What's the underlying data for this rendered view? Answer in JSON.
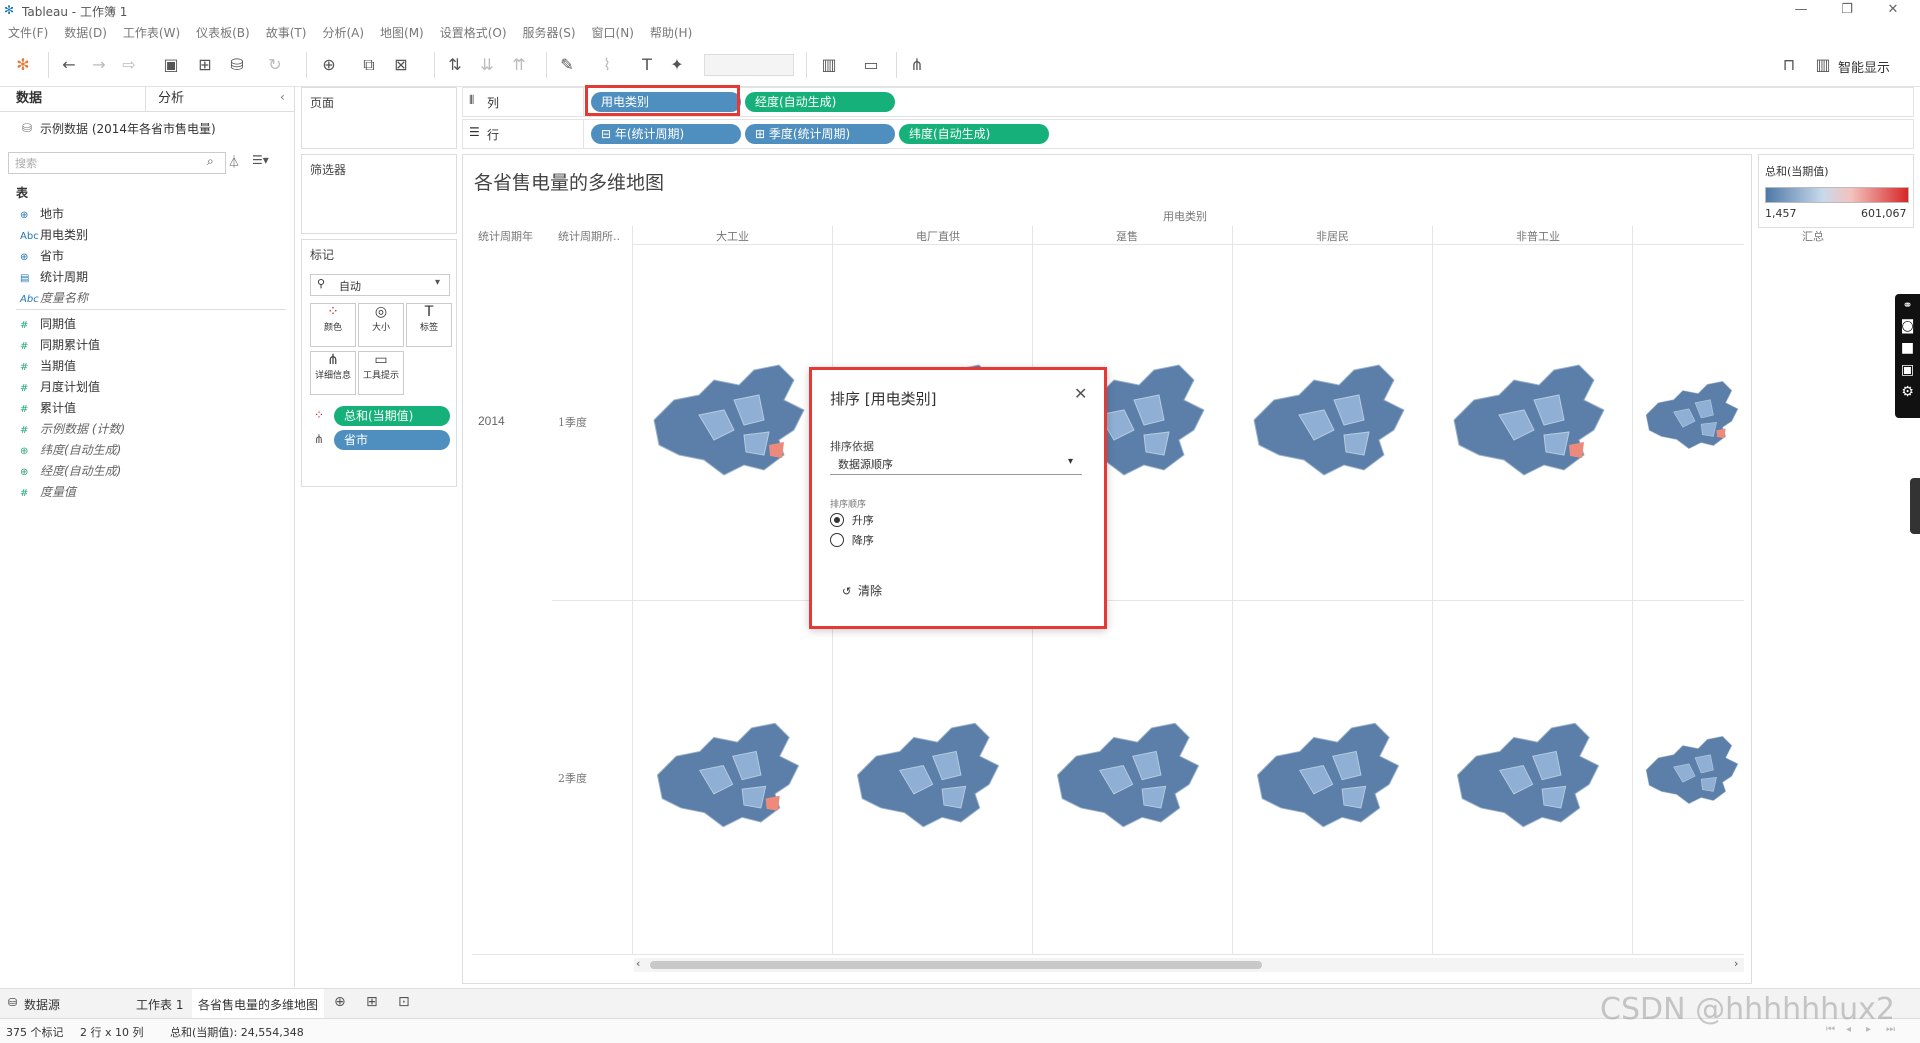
{
  "window": {
    "title": "Tableau - 工作簿 1"
  },
  "menu": [
    "文件(F)",
    "数据(D)",
    "工作表(W)",
    "仪表板(B)",
    "故事(T)",
    "分析(A)",
    "地图(M)",
    "设置格式(O)",
    "服务器(S)",
    "窗口(N)",
    "帮助(H)"
  ],
  "toolbar": {
    "show_me": "智能显示"
  },
  "left": {
    "tabs": [
      "数据",
      "分析"
    ],
    "datasource": "示例数据 (2014年各省市售电量)",
    "search_placeholder": "搜索",
    "section": "表",
    "dimensions": [
      {
        "icon": "globe-icon",
        "glyph": "⊕",
        "label": "地市",
        "italic": false
      },
      {
        "icon": "abc-icon",
        "glyph": "Abc",
        "label": "用电类别",
        "italic": false
      },
      {
        "icon": "globe-icon",
        "glyph": "⊕",
        "label": "省市",
        "italic": false
      },
      {
        "icon": "calendar-icon",
        "glyph": "▤",
        "label": "统计周期",
        "italic": false
      },
      {
        "icon": "abc-icon",
        "glyph": "Abc",
        "label": "度量名称",
        "italic": true
      }
    ],
    "measures": [
      {
        "icon": "hash-icon",
        "glyph": "#",
        "label": "同期值",
        "italic": false
      },
      {
        "icon": "hash-icon",
        "glyph": "#",
        "label": "同期累计值",
        "italic": false
      },
      {
        "icon": "hash-icon",
        "glyph": "#",
        "label": "当期值",
        "italic": false
      },
      {
        "icon": "hash-icon",
        "glyph": "#",
        "label": "月度计划值",
        "italic": false
      },
      {
        "icon": "hash-icon",
        "glyph": "#",
        "label": "累计值",
        "italic": false
      },
      {
        "icon": "hash-icon",
        "glyph": "#",
        "label": "示例数据 (计数)",
        "italic": true
      },
      {
        "icon": "globe-icon",
        "glyph": "⊕",
        "label": "纬度(自动生成)",
        "italic": true
      },
      {
        "icon": "globe-icon",
        "glyph": "⊕",
        "label": "经度(自动生成)",
        "italic": true
      },
      {
        "icon": "hash-icon",
        "glyph": "#",
        "label": "度量值",
        "italic": true
      }
    ]
  },
  "panels": {
    "pages": "页面",
    "filters": "筛选器",
    "marks": "标记"
  },
  "marks": {
    "type": "自动",
    "buttons": [
      "颜色",
      "大小",
      "标签",
      "详细信息",
      "工具提示"
    ],
    "pills": [
      {
        "label": "总和(当期值)",
        "color": "#16b07a"
      },
      {
        "label": "省市",
        "color": "#4f8fbf"
      }
    ]
  },
  "shelves": {
    "columns_label": "列",
    "rows_label": "行",
    "columns": [
      {
        "label": "用电类别",
        "color": "#4f8fbf"
      },
      {
        "label": "经度(自动生成)",
        "color": "#16b07a"
      }
    ],
    "rows": [
      {
        "label": "⊟ 年(统计周期)",
        "color": "#4f8fbf"
      },
      {
        "label": "⊞ 季度(统计周期)",
        "color": "#4f8fbf"
      },
      {
        "label": "纬度(自动生成)",
        "color": "#16b07a"
      }
    ]
  },
  "view": {
    "title": "各省售电量的多维地图",
    "col_header_title": "用电类别",
    "row_header_1": "统计周期年",
    "row_header_2": "统计周期所..",
    "categories": [
      "大工业",
      "电厂直供",
      "趸售",
      "非居民",
      "非普工业",
      "汇总"
    ],
    "year": "2014",
    "quarters": [
      "1季度",
      "2季度"
    ]
  },
  "legend": {
    "title": "总和(当期值)",
    "min": "1,457",
    "max": "601,067",
    "color_low": "#4e79a7",
    "color_high": "#d62728"
  },
  "dialog": {
    "title": "排序 [用电类别]",
    "sort_by_label": "排序依据",
    "sort_by_value": "数据源顺序",
    "order_label": "排序顺序",
    "ascending": "升序",
    "descending": "降序",
    "clear": "清除"
  },
  "bottom": {
    "datasource_tab": "数据源",
    "sheet1": "工作表 1",
    "sheet2": "各省售电量的多维地图"
  },
  "status": {
    "marks": "375 个标记",
    "dims": "2 行 x 10 列",
    "sum": "总和(当期值): 24,554,348"
  },
  "watermark": "CSDN @hhhhhhux2"
}
